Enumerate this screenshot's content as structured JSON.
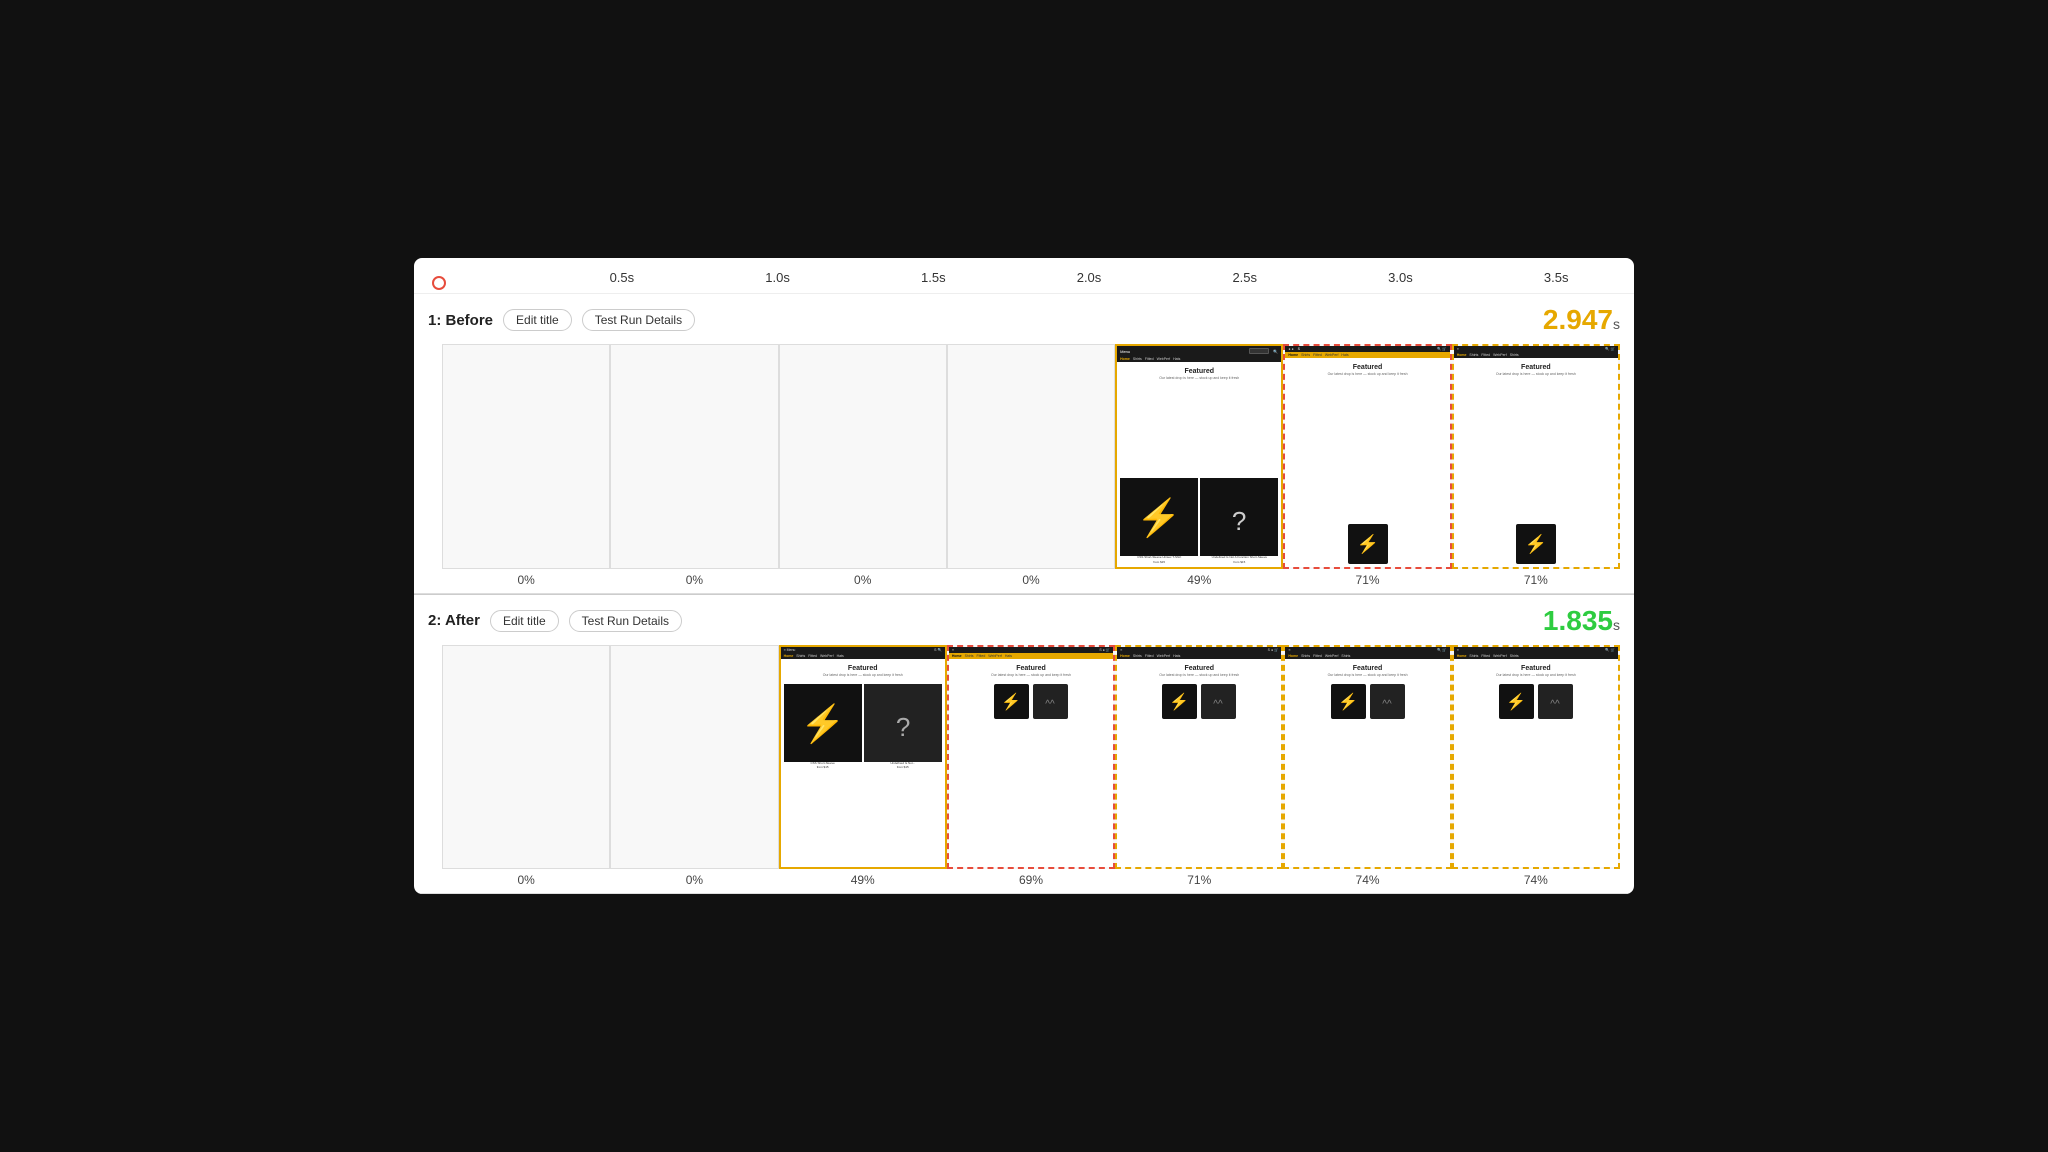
{
  "timeline": {
    "ticks": [
      "0.5s",
      "1.0s",
      "1.5s",
      "2.0s",
      "2.5s",
      "3.0s",
      "3.5s"
    ]
  },
  "before": {
    "label": "1: Before",
    "edit_title": "Edit title",
    "test_run": "Test Run Details",
    "time": "2.947",
    "unit": "s",
    "frames": [
      {
        "pct": "0%",
        "type": "blank"
      },
      {
        "pct": "0%",
        "type": "blank"
      },
      {
        "pct": "0%",
        "type": "blank"
      },
      {
        "pct": "0%",
        "type": "blank"
      },
      {
        "pct": "49%",
        "type": "content",
        "highlight": "orange"
      },
      {
        "pct": "71%",
        "type": "content",
        "highlight": "red-dashed"
      },
      {
        "pct": "71%",
        "type": "content",
        "highlight": "orange-dashed"
      }
    ]
  },
  "after": {
    "label": "2: After",
    "edit_title": "Edit title",
    "test_run": "Test Run Details",
    "time": "1.835",
    "unit": "s",
    "frames": [
      {
        "pct": "0%",
        "type": "blank"
      },
      {
        "pct": "0%",
        "type": "blank"
      },
      {
        "pct": "49%",
        "type": "content",
        "highlight": "orange"
      },
      {
        "pct": "69%",
        "type": "content",
        "highlight": "red-dashed"
      },
      {
        "pct": "71%",
        "type": "content",
        "highlight": "orange-dashed"
      },
      {
        "pct": "74%",
        "type": "content",
        "highlight": "orange-dashed"
      },
      {
        "pct": "74%",
        "type": "content",
        "highlight": "orange-dashed"
      }
    ]
  }
}
